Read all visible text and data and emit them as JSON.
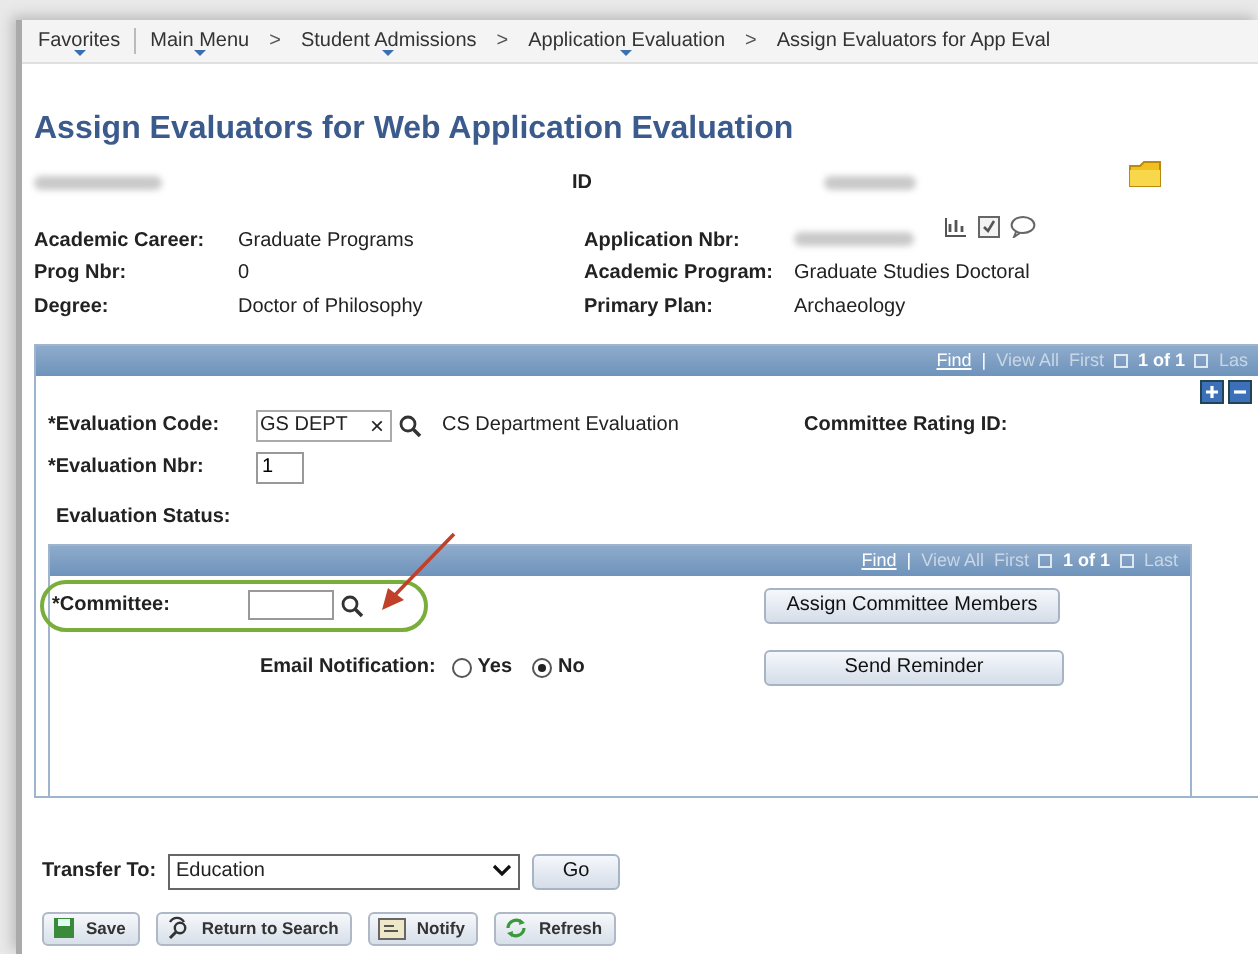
{
  "breadcrumb": [
    {
      "label": "Favorites",
      "menu": true
    },
    {
      "label": "Main Menu",
      "menu": true,
      "divider": true
    },
    {
      "label": "Student Admissions",
      "menu": true,
      "sep": ">"
    },
    {
      "label": "Application Evaluation",
      "menu": true,
      "sep": ">"
    },
    {
      "label": "Assign Evaluators for App Eval",
      "menu": false,
      "sep": ">"
    }
  ],
  "title": "Assign Evaluators for Web Application Evaluation",
  "identity": {
    "name_redacted": true,
    "id_label": "ID",
    "id_redacted": true
  },
  "details_left": [
    {
      "label": "Academic Career:",
      "value": "Graduate Programs"
    },
    {
      "label": "Prog Nbr:",
      "value": "0"
    },
    {
      "label": "Degree:",
      "value": "Doctor of Philosophy"
    }
  ],
  "details_right": [
    {
      "label": "Application Nbr:",
      "redacted": true
    },
    {
      "label": "Academic Program:",
      "value": "Graduate Studies Doctoral"
    },
    {
      "label": "Primary Plan:",
      "value": "Archaeology"
    }
  ],
  "evaluation_grid": {
    "nav": {
      "find": "Find",
      "divider": "|",
      "view_all": "View All",
      "first": "First",
      "count": "1 of 1",
      "last": "Las"
    },
    "code": {
      "label": "*Evaluation Code:",
      "value": "GS DEPT",
      "clear": "×",
      "description": "CS Department Evaluation"
    },
    "rating_label": "Committee Rating ID:",
    "nbr": {
      "label": "*Evaluation Nbr:",
      "value": "1"
    },
    "status_label": "Evaluation Status:"
  },
  "committee_grid": {
    "nav": {
      "find": "Find",
      "divider": "|",
      "view_all": "View All",
      "first": "First",
      "count": "1 of 1",
      "last": "Last"
    },
    "committee": {
      "label": "*Committee:"
    },
    "email": {
      "label": "Email Notification:",
      "options": [
        {
          "label": "Yes",
          "selected": false
        },
        {
          "label": "No",
          "selected": true
        }
      ]
    },
    "buttons": [
      "Assign Committee Members",
      "Send Reminder"
    ]
  },
  "transfer": {
    "label": "Transfer To:",
    "value": "Education",
    "button": "Go"
  },
  "toolbar": [
    {
      "label": "Save",
      "kind": "save"
    },
    {
      "label": "Return to Search",
      "kind": "search"
    },
    {
      "label": "Notify",
      "kind": "notify"
    },
    {
      "label": "Refresh",
      "kind": "refresh"
    }
  ]
}
